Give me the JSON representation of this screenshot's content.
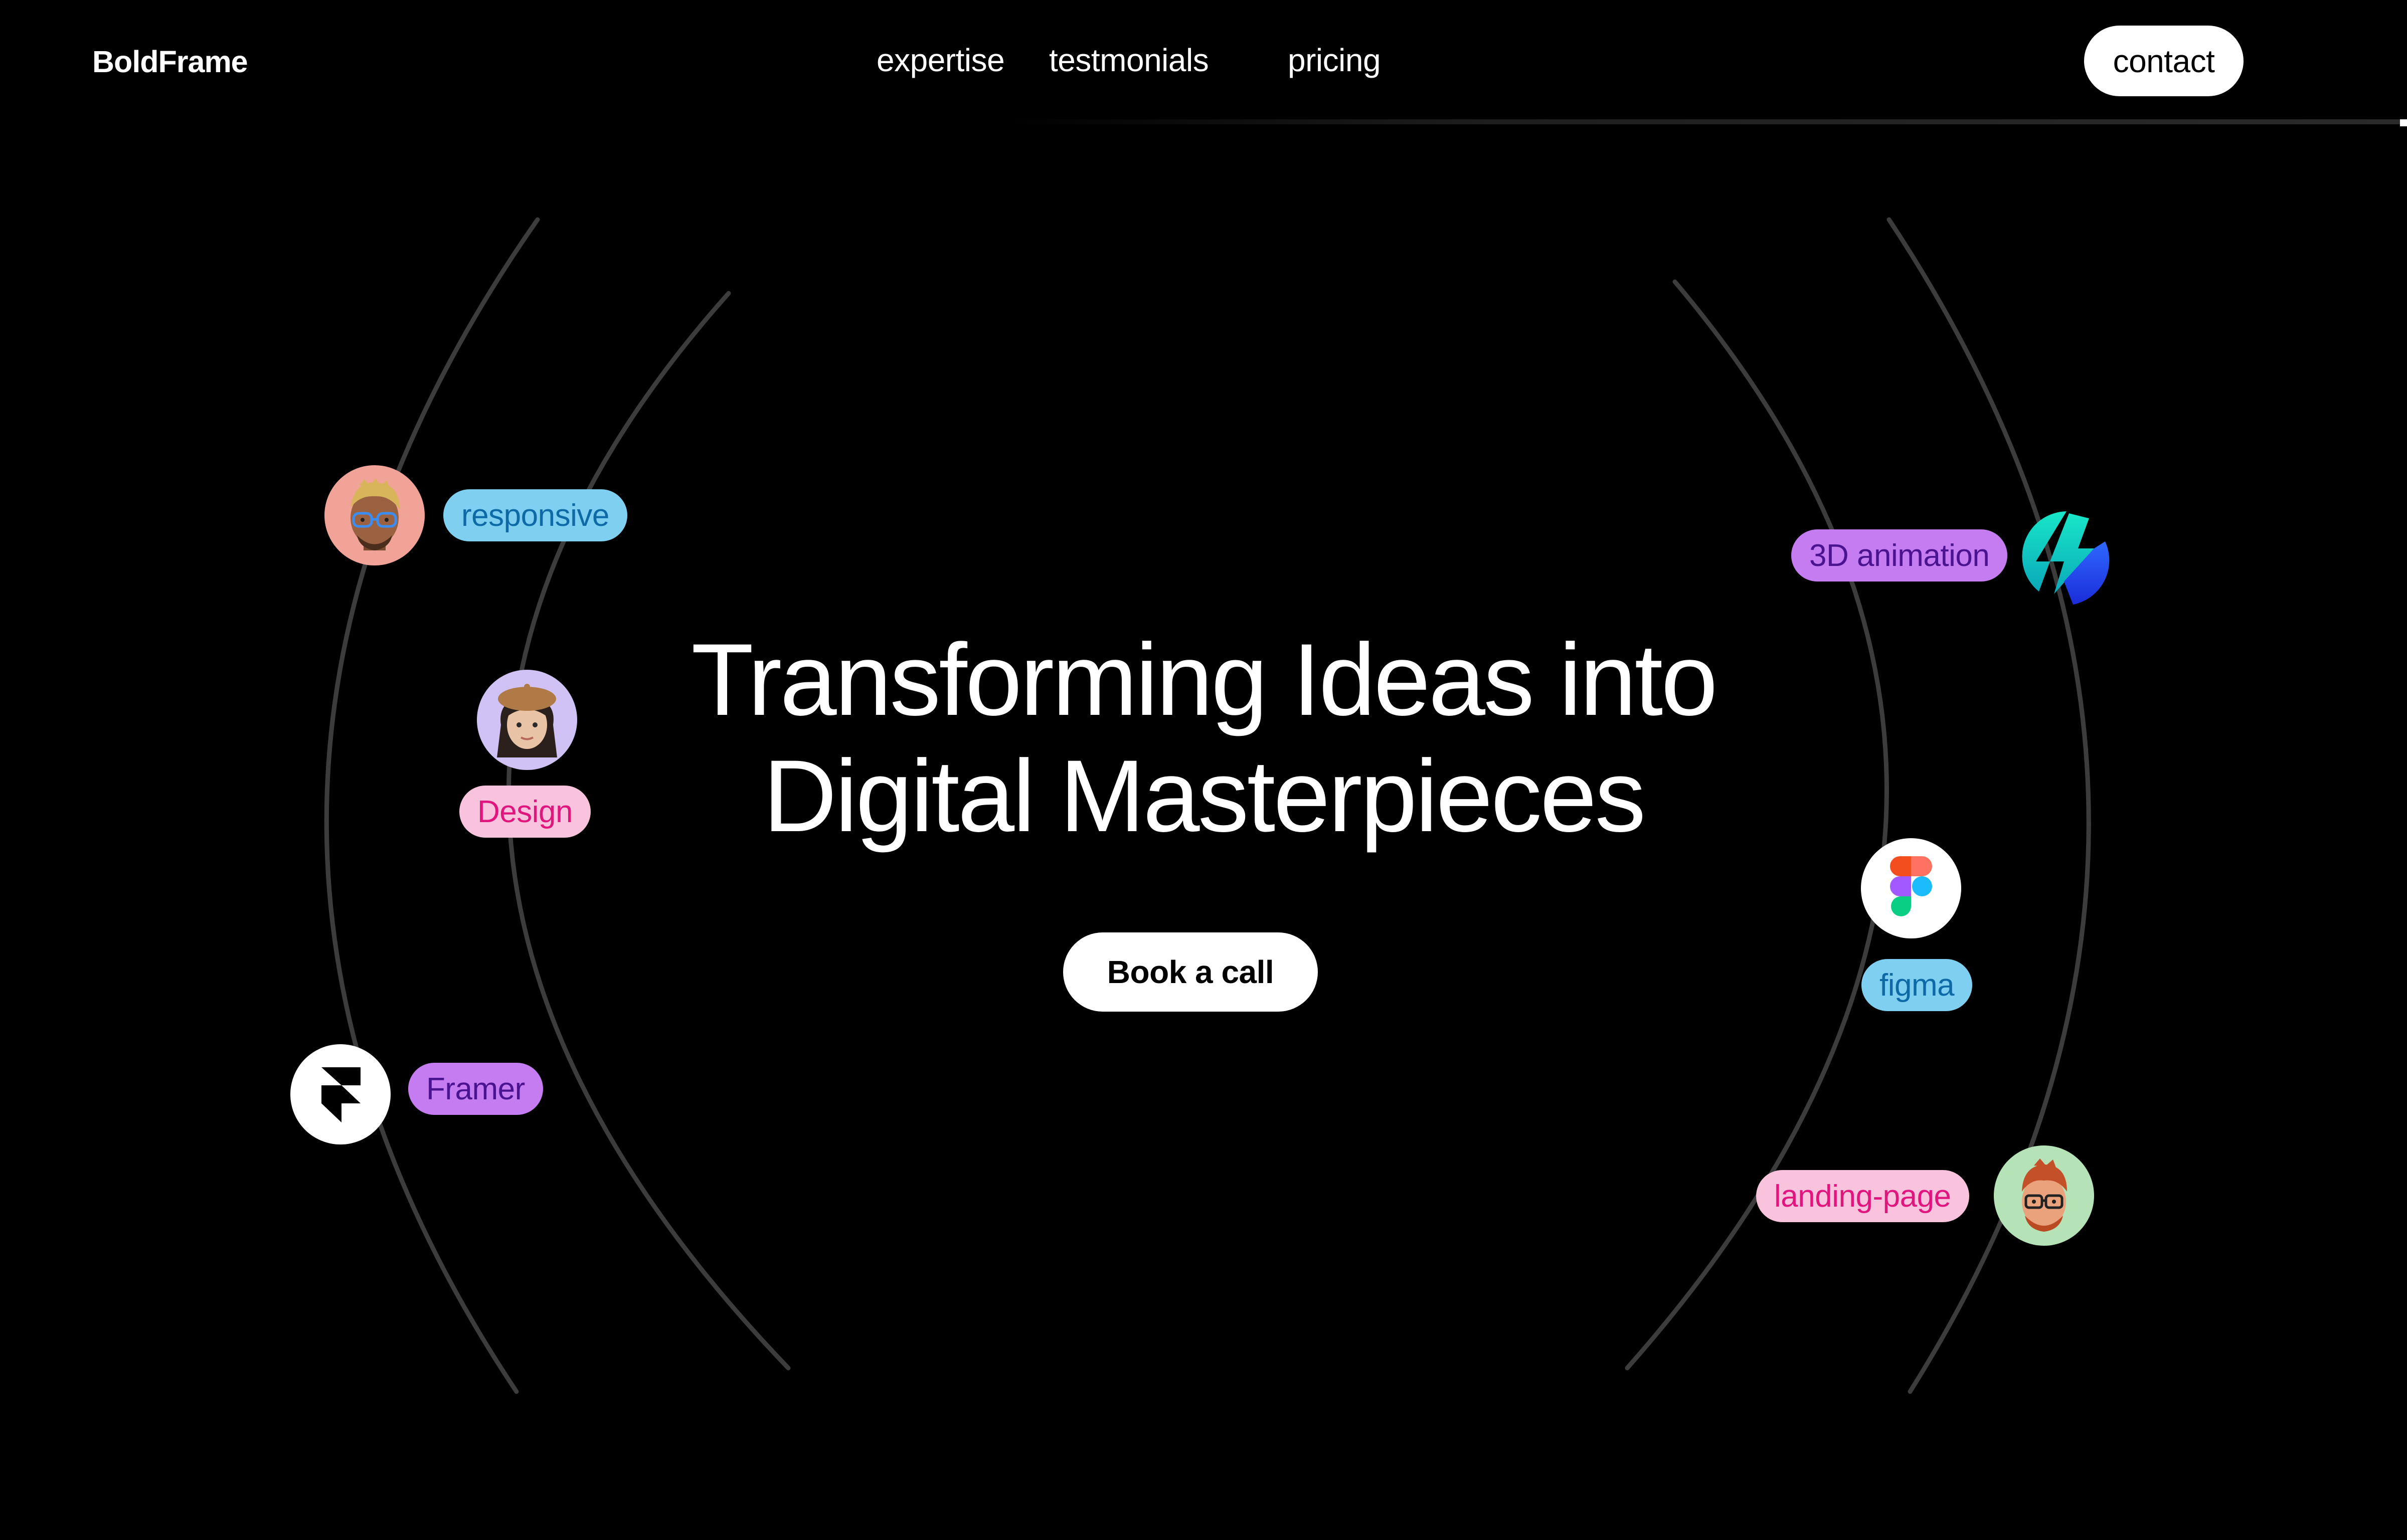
{
  "header": {
    "brand": "BoldFrame",
    "nav": {
      "expertise": "expertise",
      "testimonials": "testmonials",
      "pricing": "pricing"
    },
    "contact_label": "contact"
  },
  "hero": {
    "title_line1": "Transforming Ideas into",
    "title_line2": "Digital Masterpieces",
    "cta_label": "Book a call"
  },
  "tags": {
    "responsive": "responsive",
    "design": "Design",
    "framer": "Framer",
    "animation": "3D animation",
    "figma": "figma",
    "landing": "landing-page"
  },
  "colors": {
    "background": "#000000",
    "tag_blue_bg": "#7fcff0",
    "tag_pink_bg": "#f9c2dd",
    "tag_purple_bg": "#c57cf0"
  },
  "icons": [
    "memoji-avatar-man-glasses",
    "memoji-avatar-woman-beret",
    "framer-icon",
    "lightning-bolt-icon",
    "figma-icon",
    "memoji-avatar-red-hair"
  ]
}
